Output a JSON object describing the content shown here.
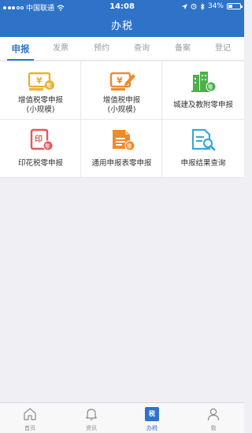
{
  "status_bar": {
    "carrier": "中国联通",
    "time": "14:08",
    "battery": "34%"
  },
  "header": {
    "title": "办税"
  },
  "tabs": [
    {
      "label": "申报",
      "active": true
    },
    {
      "label": "发票",
      "active": false
    },
    {
      "label": "预约",
      "active": false
    },
    {
      "label": "查询",
      "active": false
    },
    {
      "label": "备案",
      "active": false
    },
    {
      "label": "登记",
      "active": false
    }
  ],
  "grid": [
    {
      "label": "增值税零申报\n(小规模)",
      "icon": "vat-zero-declaration-icon"
    },
    {
      "label": "增值税申报\n(小规模)",
      "icon": "vat-declaration-icon"
    },
    {
      "label": "城建及教附零申报",
      "icon": "urban-construction-icon"
    },
    {
      "label": "印花税零申报",
      "icon": "stamp-duty-icon"
    },
    {
      "label": "通用申报表零申报",
      "icon": "general-form-icon"
    },
    {
      "label": "申报结果查询",
      "icon": "result-search-icon"
    }
  ],
  "tabbar": [
    {
      "label": "首页",
      "icon": "home-icon",
      "active": false
    },
    {
      "label": "资讯",
      "icon": "bell-icon",
      "active": false
    },
    {
      "label": "办税",
      "icon": "tax-icon",
      "icon_text": "税",
      "active": true
    },
    {
      "label": "我",
      "icon": "person-icon",
      "active": false
    }
  ],
  "colors": {
    "brand": "#2f73c9",
    "orange": "#f08a2c",
    "yellow": "#e9b330",
    "red": "#e9545c",
    "green": "#4cb14a",
    "cyan": "#3aa7d8"
  }
}
